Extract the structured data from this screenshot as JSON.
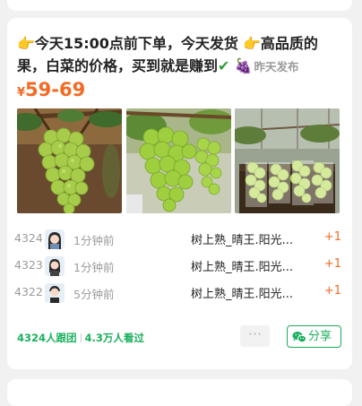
{
  "post": {
    "title_part1": "今天15:00点前下单，今天发货",
    "title_part2": "高品质的果，白菜的价格，买到就是赚到",
    "title_part3": "",
    "date_label": "昨天发布",
    "price_symbol": "¥",
    "price_range": "59-69"
  },
  "images": [
    {
      "icon": "grape-photo-1"
    },
    {
      "icon": "grape-photo-2"
    },
    {
      "icon": "grape-photo-3"
    }
  ],
  "orders": [
    {
      "id": "4324",
      "time": "1分钟前",
      "product": "树上熟_晴王.阳光...",
      "qty": "+1",
      "avatar": "avatar-girl"
    },
    {
      "id": "4323",
      "time": "1分钟前",
      "product": "树上熟_晴王.阳光...",
      "qty": "+1",
      "avatar": "avatar-girl-2"
    },
    {
      "id": "4322",
      "time": "5分钟前",
      "product": "树上熟_晴王.阳光...",
      "qty": "+1",
      "avatar": "avatar-boy"
    }
  ],
  "footer": {
    "followers": "4324人跟团",
    "views": "4.3万人看过",
    "more_label": "···",
    "share_label": "分享"
  },
  "colors": {
    "accent_orange": "#f36a24",
    "accent_green": "#1aaf5d",
    "muted": "#9a9a9a"
  }
}
